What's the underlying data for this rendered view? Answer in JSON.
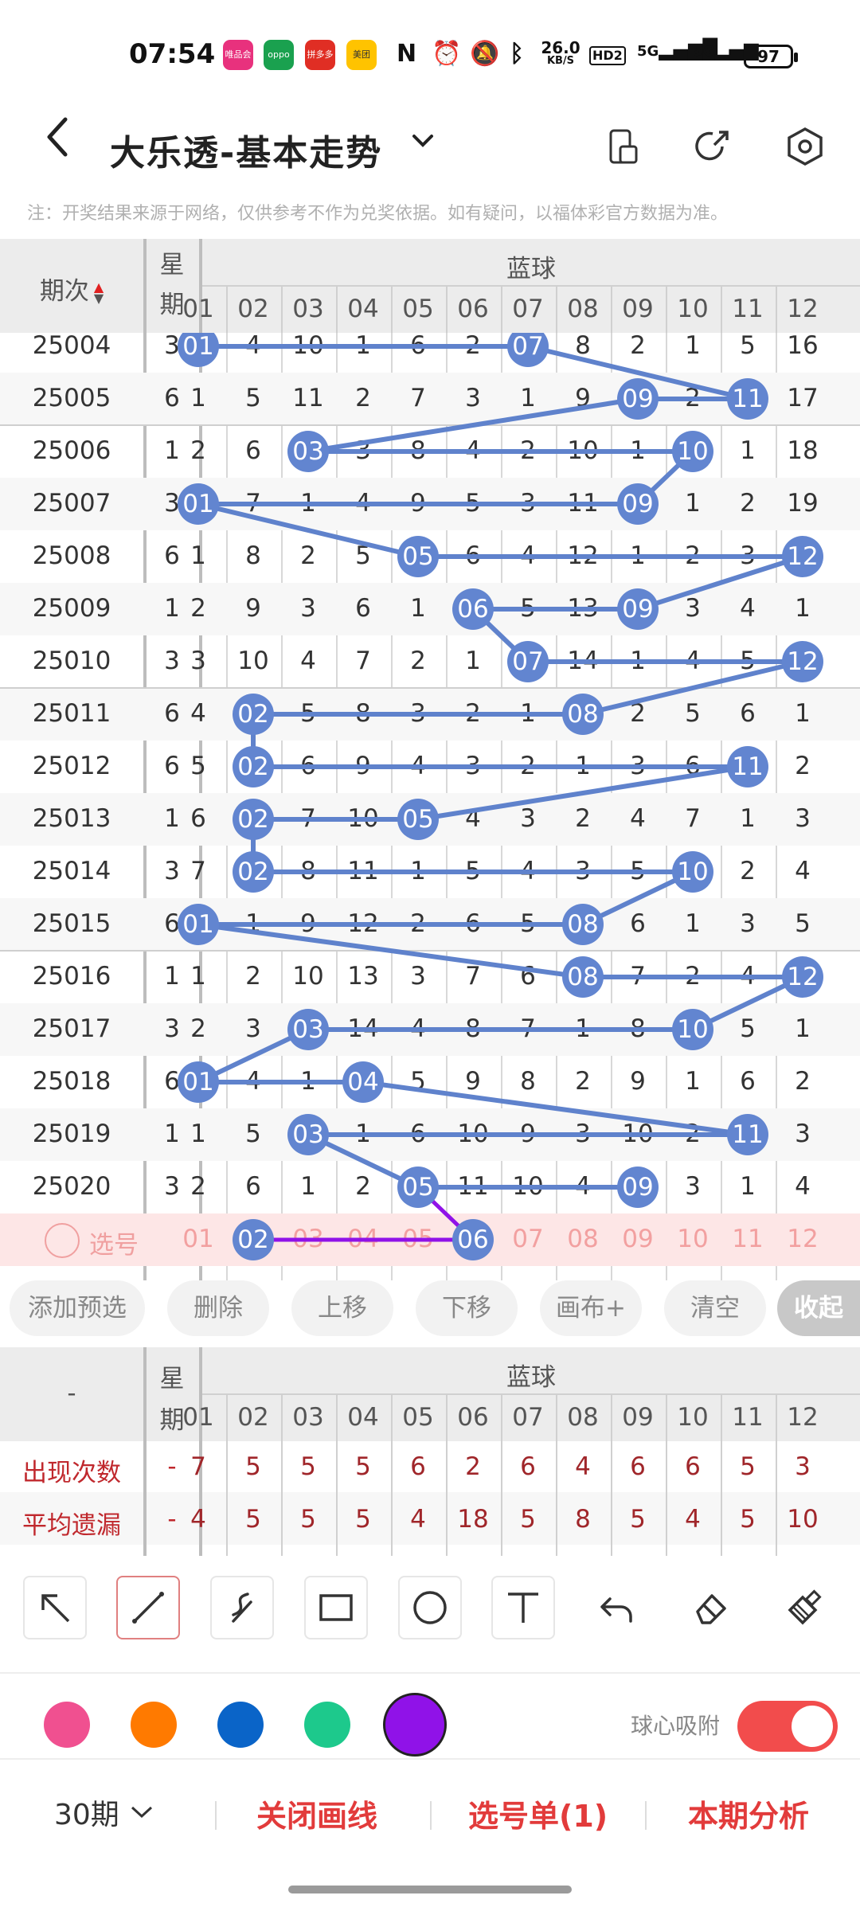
{
  "status": {
    "time": "07:54",
    "net_speed_top": "26.0",
    "net_speed_unit": "KB/S",
    "hd": "HD2",
    "net1": "5G",
    "net2": "5G",
    "battery": "97",
    "apps": [
      {
        "name": "唯品会",
        "color": "#e8317d"
      },
      {
        "name": "oppo",
        "color": "#1aa14f"
      },
      {
        "name": "拼多多",
        "color": "#e02e24"
      },
      {
        "name": "美团",
        "color": "#ffc300"
      }
    ]
  },
  "header": {
    "back_icon": "chevron-left-icon",
    "title": "大乐透-基本走势",
    "dropdown_icon": "chevron-down-icon",
    "icons": [
      "phone-rotate-icon",
      "share-icon",
      "settings-hexagon-icon"
    ]
  },
  "notice": "注：开奖结果来源于网络，仅供参考不作为兑奖依据。如有疑问，以福体彩官方数据为准。",
  "grid": {
    "col_issue": "期次",
    "col_week": "星期",
    "group_label": "蓝球",
    "numbers": [
      "01",
      "02",
      "03",
      "04",
      "05",
      "06",
      "07",
      "08",
      "09",
      "10",
      "11",
      "12"
    ],
    "rows": [
      {
        "issue": "25004",
        "week": "3",
        "vals": [
          "01",
          "4",
          "10",
          "1",
          "6",
          "2",
          "07",
          "8",
          "2",
          "1",
          "5",
          "16"
        ]
      },
      {
        "issue": "25005",
        "week": "6",
        "vals": [
          "1",
          "5",
          "11",
          "2",
          "7",
          "3",
          "1",
          "9",
          "09",
          "2",
          "11",
          "17"
        ]
      },
      {
        "issue": "25006",
        "week": "1",
        "vals": [
          "2",
          "6",
          "03",
          "3",
          "8",
          "4",
          "2",
          "10",
          "1",
          "10",
          "1",
          "18"
        ]
      },
      {
        "issue": "25007",
        "week": "3",
        "vals": [
          "01",
          "7",
          "1",
          "4",
          "9",
          "5",
          "3",
          "11",
          "09",
          "1",
          "2",
          "19"
        ]
      },
      {
        "issue": "25008",
        "week": "6",
        "vals": [
          "1",
          "8",
          "2",
          "5",
          "05",
          "6",
          "4",
          "12",
          "1",
          "2",
          "3",
          "12"
        ]
      },
      {
        "issue": "25009",
        "week": "1",
        "vals": [
          "2",
          "9",
          "3",
          "6",
          "1",
          "06",
          "5",
          "13",
          "09",
          "3",
          "4",
          "1"
        ]
      },
      {
        "issue": "25010",
        "week": "3",
        "vals": [
          "3",
          "10",
          "4",
          "7",
          "2",
          "1",
          "07",
          "14",
          "1",
          "4",
          "5",
          "12"
        ]
      },
      {
        "issue": "25011",
        "week": "6",
        "vals": [
          "4",
          "02",
          "5",
          "8",
          "3",
          "2",
          "1",
          "08",
          "2",
          "5",
          "6",
          "1"
        ]
      },
      {
        "issue": "25012",
        "week": "6",
        "vals": [
          "5",
          "02",
          "6",
          "9",
          "4",
          "3",
          "2",
          "1",
          "3",
          "6",
          "11",
          "2"
        ]
      },
      {
        "issue": "25013",
        "week": "1",
        "vals": [
          "6",
          "02",
          "7",
          "10",
          "05",
          "4",
          "3",
          "2",
          "4",
          "7",
          "1",
          "3"
        ]
      },
      {
        "issue": "25014",
        "week": "3",
        "vals": [
          "7",
          "02",
          "8",
          "11",
          "1",
          "5",
          "4",
          "3",
          "5",
          "10",
          "2",
          "4"
        ]
      },
      {
        "issue": "25015",
        "week": "6",
        "vals": [
          "01",
          "1",
          "9",
          "12",
          "2",
          "6",
          "5",
          "08",
          "6",
          "1",
          "3",
          "5"
        ]
      },
      {
        "issue": "25016",
        "week": "1",
        "vals": [
          "1",
          "2",
          "10",
          "13",
          "3",
          "7",
          "6",
          "08",
          "7",
          "2",
          "4",
          "12"
        ]
      },
      {
        "issue": "25017",
        "week": "3",
        "vals": [
          "2",
          "3",
          "03",
          "14",
          "4",
          "8",
          "7",
          "1",
          "8",
          "10",
          "5",
          "1"
        ]
      },
      {
        "issue": "25018",
        "week": "6",
        "vals": [
          "01",
          "4",
          "1",
          "04",
          "5",
          "9",
          "8",
          "2",
          "9",
          "1",
          "6",
          "2"
        ]
      },
      {
        "issue": "25019",
        "week": "1",
        "vals": [
          "1",
          "5",
          "03",
          "1",
          "6",
          "10",
          "9",
          "3",
          "10",
          "2",
          "11",
          "3"
        ]
      },
      {
        "issue": "25020",
        "week": "3",
        "vals": [
          "2",
          "6",
          "1",
          "2",
          "05",
          "11",
          "10",
          "4",
          "09",
          "3",
          "1",
          "4"
        ]
      }
    ],
    "hits": [
      [
        0,
        6
      ],
      [
        8,
        10
      ],
      [
        2,
        9
      ],
      [
        0,
        8
      ],
      [
        4,
        11
      ],
      [
        5,
        8
      ],
      [
        6,
        11
      ],
      [
        1,
        7
      ],
      [
        1,
        10
      ],
      [
        1,
        4
      ],
      [
        1,
        9
      ],
      [
        0,
        7
      ],
      [
        7,
        11
      ],
      [
        2,
        9
      ],
      [
        0,
        3
      ],
      [
        2,
        10
      ],
      [
        4,
        8
      ]
    ],
    "pick_label": "选号",
    "picked": [
      1,
      5
    ]
  },
  "buttons": [
    "添加预选",
    "删除",
    "上移",
    "下移",
    "画布+",
    "清空",
    "收起"
  ],
  "stats": {
    "dash": "-",
    "col_week": "星期",
    "group_label": "蓝球",
    "numbers": [
      "01",
      "02",
      "03",
      "04",
      "05",
      "06",
      "07",
      "08",
      "09",
      "10",
      "11",
      "12"
    ],
    "rows": [
      {
        "label": "出现次数",
        "week": "-",
        "vals": [
          "7",
          "5",
          "5",
          "5",
          "6",
          "2",
          "6",
          "4",
          "6",
          "6",
          "5",
          "3"
        ]
      },
      {
        "label": "平均遗漏",
        "week": "-",
        "vals": [
          "4",
          "5",
          "5",
          "5",
          "4",
          "18",
          "5",
          "8",
          "5",
          "4",
          "5",
          "10"
        ]
      }
    ]
  },
  "tools": [
    "arrow-tool-icon",
    "line-tool-icon",
    "curve-tool-icon",
    "rectangle-tool-icon",
    "circle-tool-icon",
    "text-tool-icon",
    "undo-icon",
    "eraser-icon",
    "clear-brush-icon"
  ],
  "colors": [
    "#f05090",
    "#ff7a00",
    "#0a64c8",
    "#1dc98c",
    "#9012e8"
  ],
  "snap_label": "球心吸附",
  "snap_on": true,
  "footer": {
    "period": "30期",
    "close_lines": "关闭画线",
    "pick_list": "选号单(1)",
    "analysis": "本期分析"
  }
}
